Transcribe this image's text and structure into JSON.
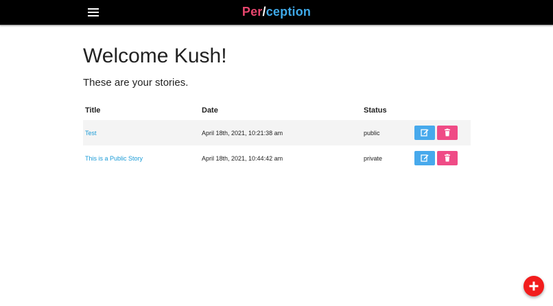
{
  "nav": {
    "menu_icon": "hamburger-menu-icon",
    "brand_part1": "Per",
    "brand_slash": "/",
    "brand_part2": "ception",
    "colors": {
      "brand_pink": "#e8466e",
      "brand_blue": "#3fa9e8",
      "bar": "#000000"
    }
  },
  "main": {
    "heading": "Welcome Kush!",
    "subheading": "These are your stories."
  },
  "table": {
    "headers": {
      "title": "Title",
      "date": "Date",
      "status": "Status"
    },
    "rows": [
      {
        "title": "Test",
        "date": "April 18th, 2021, 10:21:38 am",
        "status": "public"
      },
      {
        "title": "This is a Public Story",
        "date": "April 18th, 2021, 10:44:42 am",
        "status": "private"
      }
    ],
    "icons": {
      "edit": "edit-icon",
      "delete": "trash-icon"
    },
    "colors": {
      "edit": "#47a9ec",
      "delete": "#ef4b86",
      "link": "#1a9bd7"
    }
  },
  "fab": {
    "icon": "plus-icon",
    "color": "#f21d1d"
  }
}
